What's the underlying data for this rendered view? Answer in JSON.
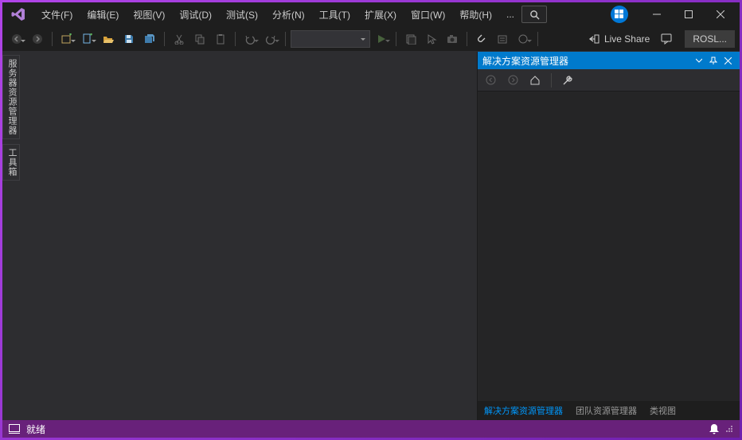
{
  "menu": {
    "file": "文件(F)",
    "edit": "编辑(E)",
    "view": "视图(V)",
    "debug": "调试(D)",
    "test": "测试(S)",
    "analyze": "分析(N)",
    "tools": "工具(T)",
    "extensions": "扩展(X)",
    "window": "窗口(W)",
    "help": "帮助(H)",
    "overflow": "..."
  },
  "toolbar": {
    "live_share": "Live Share",
    "ros_button": "ROSL..."
  },
  "side_tabs": {
    "server_explorer": "服务器资源管理器",
    "toolbox": "工具箱"
  },
  "panel": {
    "title": "解决方案资源管理器",
    "bottom_tabs": {
      "solution_explorer": "解决方案资源管理器",
      "team_explorer": "团队资源管理器",
      "class_view": "类视图"
    }
  },
  "status": {
    "ready": "就绪"
  }
}
